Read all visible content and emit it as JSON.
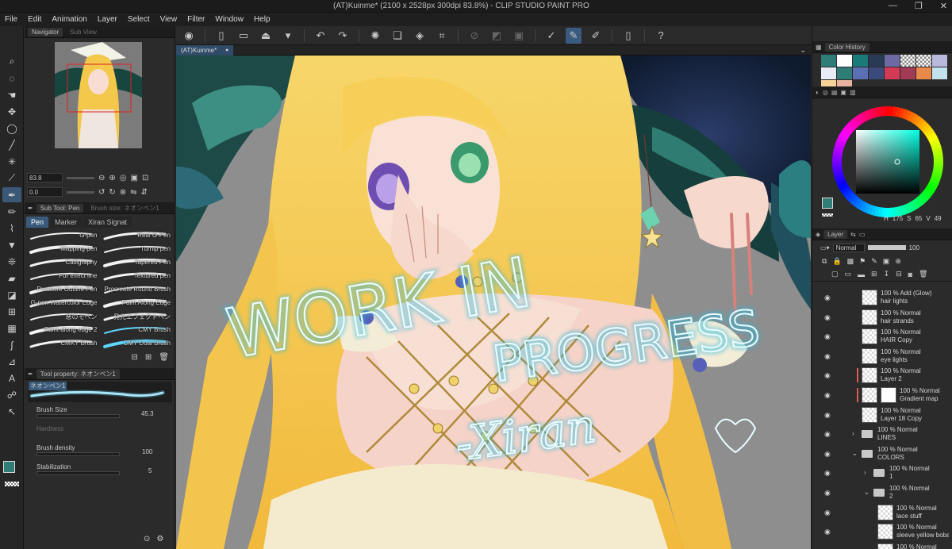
{
  "window": {
    "title": "(AT)Kuinme* (2100 x 2528px 300dpi 83.8%)  - CLIP STUDIO PAINT PRO",
    "controls": [
      "—",
      "❐",
      "✕"
    ]
  },
  "menu": [
    "File",
    "Edit",
    "Animation",
    "Layer",
    "Select",
    "View",
    "Filter",
    "Window",
    "Help"
  ],
  "navigator": {
    "tab_label": "Navigator",
    "tab2_label": "Sub View",
    "zoom": "83.8",
    "rotation": "0.0"
  },
  "subtool": {
    "tab_label": "Sub Tool: Pen",
    "tab2_label": "Brush size: ネオンペン1",
    "tabs": [
      "Pen",
      "Marker",
      "Xiran Signat"
    ],
    "brushes": [
      "G-pen",
      "Real G-Pen",
      "Mapping pen",
      "Turnip pen",
      "Calligraphy",
      "Tapered Pen",
      "For effect line",
      "Textured pen",
      "Pressure Outline Pen",
      "Procreate Round Brush",
      "G-pen Watercolor Edge",
      "Paint Along Edge",
      "悪のモペン",
      "発光エフェクトペン",
      "Paint along edge 2",
      "CMY Brush",
      "CMKY Brush",
      "CMY Dual Brush"
    ]
  },
  "toolprop": {
    "tab_label": "Tool property: ネオンペン1",
    "preset_name": "ネオンペン1",
    "props": [
      {
        "label": "Brush Size",
        "value": "45.3"
      },
      {
        "label": "Hardness",
        "value": ""
      },
      {
        "label": "Brush density",
        "value": "100"
      },
      {
        "label": "Stabilization",
        "value": "5"
      }
    ]
  },
  "canvas": {
    "tab_label": "(AT)Kuinme*",
    "overlay_line1": "WORK IN",
    "overlay_line2": "PROGRESS",
    "overlay_signature": "-Xiran"
  },
  "colorhistory": {
    "tab_label": "Color History",
    "swatches": [
      "#2f7d76",
      "#ffffff",
      "#1a7a7a",
      "#283a55",
      "#6d6aa3",
      "checker",
      "checker",
      "#b9b9dd",
      "#e9ecf6",
      "#2f7d76",
      "#5b6fb5",
      "#3a4a7a",
      "#d23a55",
      "#a03a55",
      "#e98a4a",
      "#c4e2ee",
      "#f7d39a",
      "#e7b2a0"
    ]
  },
  "colorwheel": {
    "hsv": {
      "h": "175",
      "s": "65",
      "v": "49"
    },
    "labels": {
      "h": "H",
      "s": "S",
      "v": "V"
    }
  },
  "layers": {
    "tab_label": "Layer",
    "blend_mode": "Normal",
    "opacity": "100",
    "items": [
      {
        "line1": "100 % Add (Glow)",
        "line2": "hair lights"
      },
      {
        "line1": "100 % Normal",
        "line2": "hair strands"
      },
      {
        "line1": "100 % Normal",
        "line2": "HAIR Copy"
      },
      {
        "line1": "100 % Normal",
        "line2": "eye lights"
      },
      {
        "line1": "100 % Normal",
        "line2": "Layer 2"
      },
      {
        "line1": "100 % Normal",
        "line2": "Gradient map"
      },
      {
        "line1": "100 % Normal",
        "line2": "Layer 18 Copy"
      },
      {
        "line1": "100 % Normal",
        "line2": "LINES"
      },
      {
        "line1": "100 % Normal",
        "line2": "COLORS"
      },
      {
        "line1": "100 % Normal",
        "line2": "1"
      },
      {
        "line1": "100 % Normal",
        "line2": "2"
      },
      {
        "line1": "100 % Normal",
        "line2": "lace stuff"
      },
      {
        "line1": "100 % Normal",
        "line2": "sleeve yellow boba"
      },
      {
        "line1": "100 % Normal",
        "line2": "..."
      }
    ]
  }
}
